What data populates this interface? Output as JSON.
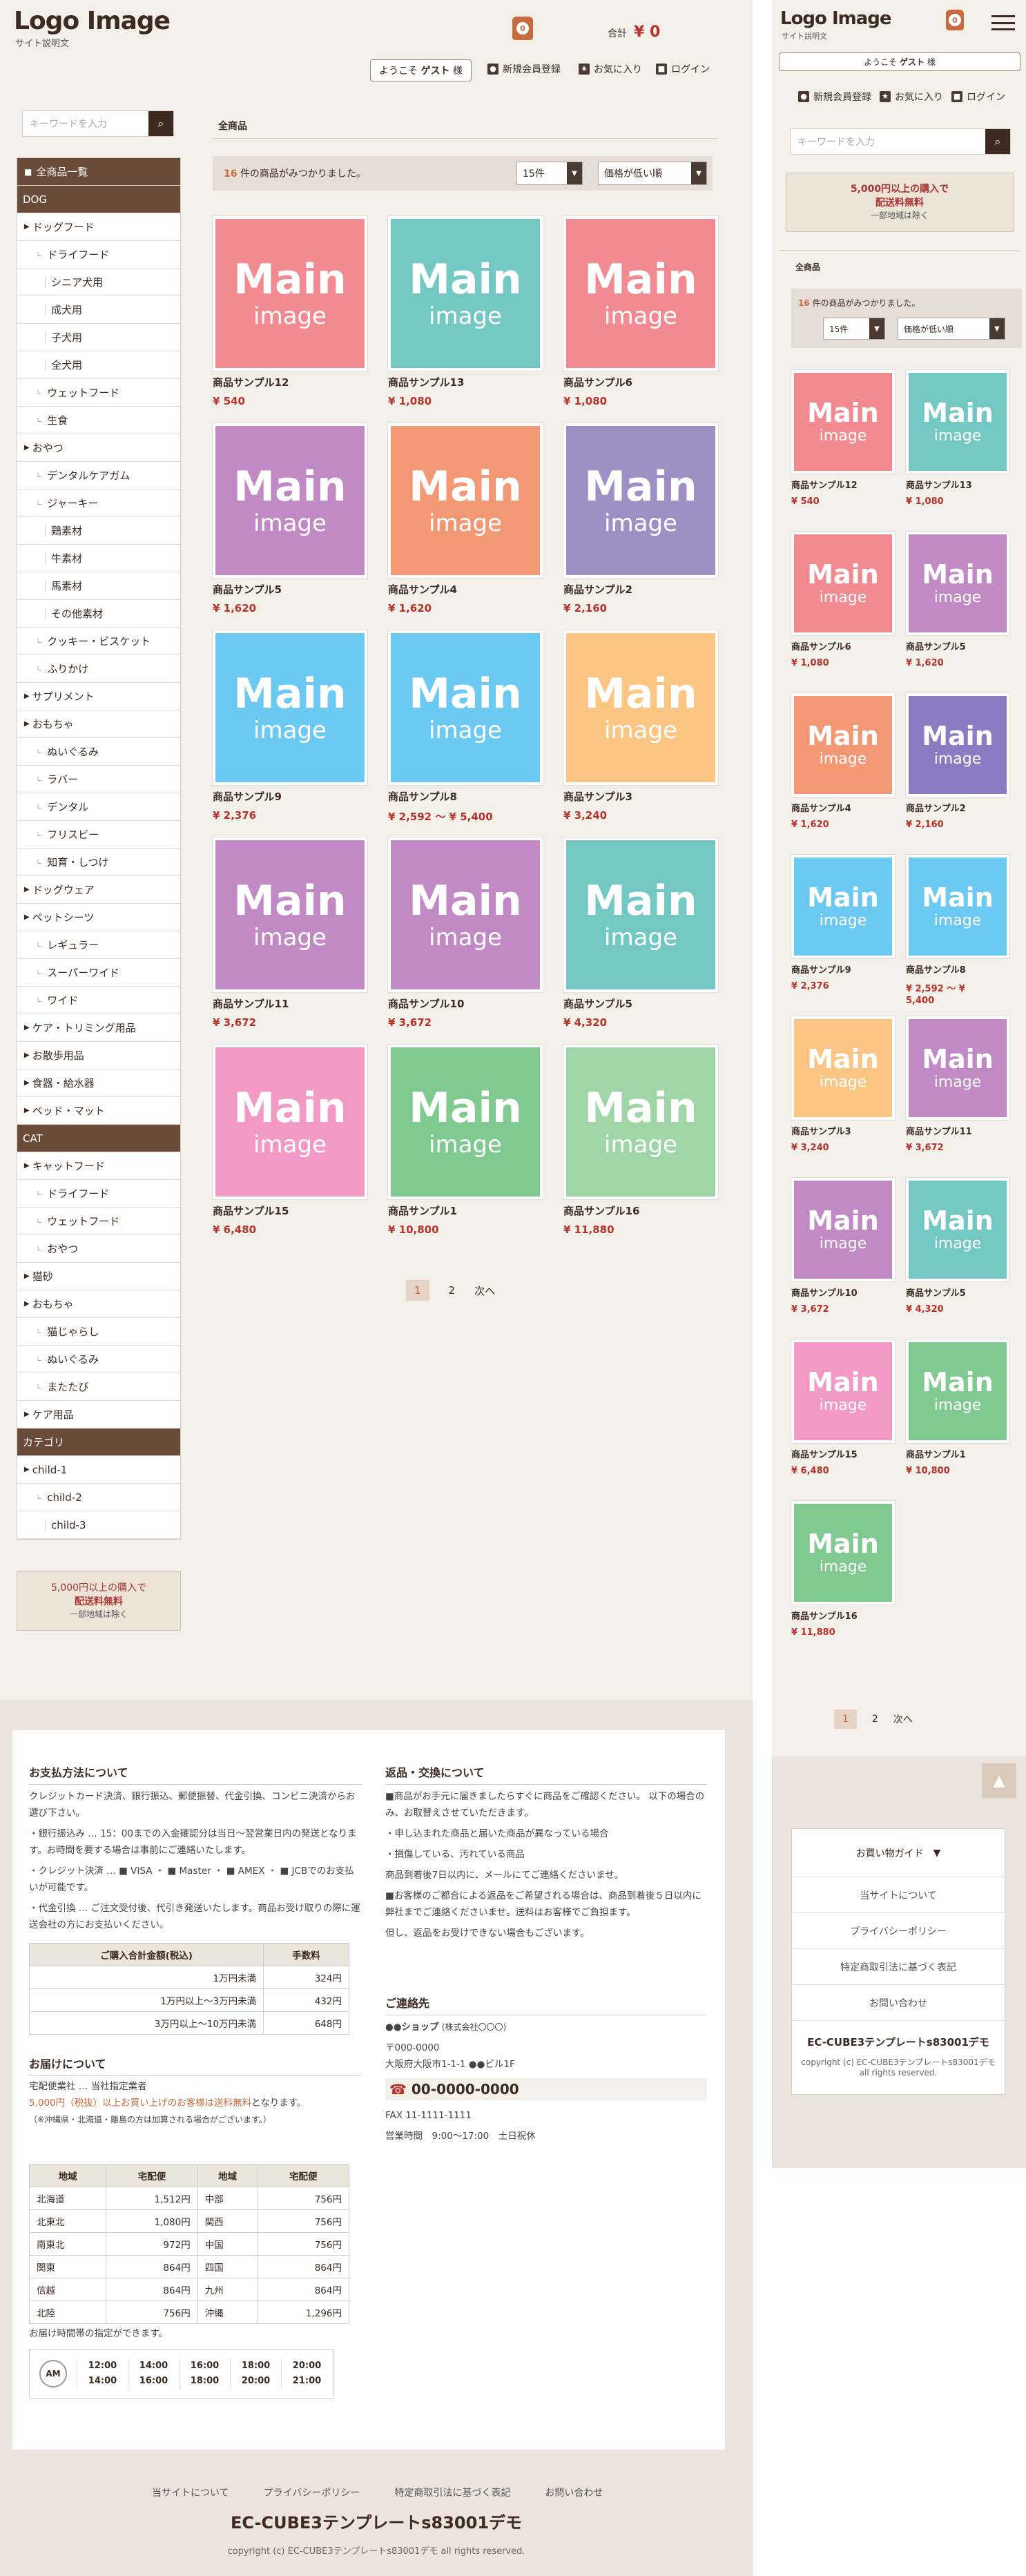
{
  "header": {
    "logo": "Logo Image",
    "sub": "サイト説明文",
    "cart_count": "0",
    "total_label": "合計",
    "total_value": "¥ 0",
    "welcome": "ようこそ",
    "guest": "ゲスト",
    "sama": "様",
    "links": [
      "新規会員登録",
      "お気に入り",
      "ログイン"
    ]
  },
  "search": {
    "placeholder": "キーワードを入力"
  },
  "sidebar": [
    {
      "t": "全商品一覧",
      "k": "top"
    },
    {
      "t": "DOG",
      "k": "h"
    },
    {
      "t": "ドッグフード",
      "k": "tri"
    },
    {
      "t": "ドライフード",
      "k": "s1"
    },
    {
      "t": "シニア犬用",
      "k": "s2"
    },
    {
      "t": "成犬用",
      "k": "s2"
    },
    {
      "t": "子犬用",
      "k": "s2"
    },
    {
      "t": "全犬用",
      "k": "s2"
    },
    {
      "t": "ウェットフード",
      "k": "s1"
    },
    {
      "t": "生食",
      "k": "s1"
    },
    {
      "t": "おやつ",
      "k": "tri"
    },
    {
      "t": "デンタルケアガム",
      "k": "s1"
    },
    {
      "t": "ジャーキー",
      "k": "s1"
    },
    {
      "t": "鶏素材",
      "k": "s2"
    },
    {
      "t": "牛素材",
      "k": "s2"
    },
    {
      "t": "馬素材",
      "k": "s2"
    },
    {
      "t": "その他素材",
      "k": "s2"
    },
    {
      "t": "クッキー・ビスケット",
      "k": "s1"
    },
    {
      "t": "ふりかけ",
      "k": "s1"
    },
    {
      "t": "サプリメント",
      "k": "tri"
    },
    {
      "t": "おもちゃ",
      "k": "tri"
    },
    {
      "t": "ぬいぐるみ",
      "k": "s1"
    },
    {
      "t": "ラバー",
      "k": "s1"
    },
    {
      "t": "デンタル",
      "k": "s1"
    },
    {
      "t": "フリスビー",
      "k": "s1"
    },
    {
      "t": "知育・しつけ",
      "k": "s1"
    },
    {
      "t": "ドッグウェア",
      "k": "tri"
    },
    {
      "t": "ペットシーツ",
      "k": "tri"
    },
    {
      "t": "レギュラー",
      "k": "s1"
    },
    {
      "t": "スーパーワイド",
      "k": "s1"
    },
    {
      "t": "ワイド",
      "k": "s1"
    },
    {
      "t": "ケア・トリミング用品",
      "k": "tri"
    },
    {
      "t": "お散歩用品",
      "k": "tri"
    },
    {
      "t": "食器・給水器",
      "k": "tri"
    },
    {
      "t": "ベッド・マット",
      "k": "tri"
    },
    {
      "t": "CAT",
      "k": "h"
    },
    {
      "t": "キャットフード",
      "k": "tri"
    },
    {
      "t": "ドライフード",
      "k": "s1"
    },
    {
      "t": "ウェットフード",
      "k": "s1"
    },
    {
      "t": "おやつ",
      "k": "s1"
    },
    {
      "t": "猫砂",
      "k": "tri"
    },
    {
      "t": "おもちゃ",
      "k": "tri"
    },
    {
      "t": "猫じゃらし",
      "k": "s1"
    },
    {
      "t": "ぬいぐるみ",
      "k": "s1"
    },
    {
      "t": "またたび",
      "k": "s1"
    },
    {
      "t": "ケア用品",
      "k": "tri"
    },
    {
      "t": "カテゴリ",
      "k": "h"
    },
    {
      "t": "child-1",
      "k": "tri"
    },
    {
      "t": "child-2",
      "k": "s1"
    },
    {
      "t": "child-3",
      "k": "s2"
    }
  ],
  "ship": {
    "l1": "5,000円以上の購入で",
    "l2": "配送料無料",
    "l3": "一部地域は除く"
  },
  "main": {
    "breadcrumb": "全商品",
    "count": "16",
    "count_text": "件の商品がみつかりました。",
    "per_page": "15件",
    "sort": "価格が低い順"
  },
  "products": [
    {
      "name": "商品サンプル12",
      "price": "¥ 540",
      "color": "#f28b91"
    },
    {
      "name": "商品サンプル13",
      "price": "¥ 1,080",
      "color": "#74c8c3"
    },
    {
      "name": "商品サンプル6",
      "price": "¥ 1,080",
      "color": "#f28b91"
    },
    {
      "name": "商品サンプル5",
      "price": "¥ 1,620",
      "color": "#c18ac4"
    },
    {
      "name": "商品サンプル4",
      "price": "¥ 1,620",
      "color": "#f29875"
    },
    {
      "name": "商品サンプル2",
      "price": "¥ 2,160",
      "color": "#a08fc4"
    },
    {
      "name": "商品サンプル9",
      "price": "¥ 2,376",
      "color": "#6ccaf2"
    },
    {
      "name": "商品サンプル8",
      "price": "¥ 2,592 ～ ¥ 5,400",
      "color": "#6ccaf2"
    },
    {
      "name": "商品サンプル3",
      "price": "¥ 3,240",
      "color": "#fbc583"
    },
    {
      "name": "商品サンプル11",
      "price": "¥ 3,672",
      "color": "#c18ac4"
    },
    {
      "name": "商品サンプル10",
      "price": "¥ 3,672",
      "color": "#c18ac4"
    },
    {
      "name": "商品サンプル5",
      "price": "¥ 4,320",
      "color": "#74c8c3"
    },
    {
      "name": "商品サンプル15",
      "price": "¥ 6,480",
      "color": "#f29ac5"
    },
    {
      "name": "商品サンプル1",
      "price": "¥ 10,800",
      "color": "#80c990"
    },
    {
      "name": "商品サンプル16",
      "price": "¥ 11,880",
      "color": "#9fd5a7"
    }
  ],
  "mobile_products": [
    {
      "name": "商品サンプル12",
      "price": "¥ 540",
      "color": "#f28b91"
    },
    {
      "name": "商品サンプル13",
      "price": "¥ 1,080",
      "color": "#74c8c3"
    },
    {
      "name": "商品サンプル6",
      "price": "¥ 1,080",
      "color": "#f28b91"
    },
    {
      "name": "商品サンプル5",
      "price": "¥ 1,620",
      "color": "#c18ac4"
    },
    {
      "name": "商品サンプル4",
      "price": "¥ 1,620",
      "color": "#f29875"
    },
    {
      "name": "商品サンプル2",
      "price": "¥ 2,160",
      "color": "#8a7bc2"
    },
    {
      "name": "商品サンプル9",
      "price": "¥ 2,376",
      "color": "#6ccaf2"
    },
    {
      "name": "商品サンプル8",
      "price": "¥ 2,592 ～ ¥",
      "price2": "5,400",
      "color": "#6ccaf2"
    },
    {
      "name": "商品サンプル3",
      "price": "¥ 3,240",
      "color": "#fbc583"
    },
    {
      "name": "商品サンプル11",
      "price": "¥ 3,672",
      "color": "#c18ac4"
    },
    {
      "name": "商品サンプル10",
      "price": "¥ 3,672",
      "color": "#c18ac4"
    },
    {
      "name": "商品サンプル5",
      "price": "¥ 4,320",
      "color": "#74c8c3"
    },
    {
      "name": "商品サンプル15",
      "price": "¥ 6,480",
      "color": "#f29ac5"
    },
    {
      "name": "商品サンプル1",
      "price": "¥ 10,800",
      "color": "#80c990"
    },
    {
      "name": "商品サンプル16",
      "price": "¥ 11,880",
      "color": "#80c990"
    }
  ],
  "tile": {
    "main": "Main",
    "image": "image"
  },
  "pagination": {
    "p1": "1",
    "p2": "2",
    "next": "次へ"
  },
  "footer": {
    "pay_title": "お支払方法について",
    "pay_text": "クレジットカード決済、銀行振込、郵便振替、代金引換、コンビニ決済からお選び下さい。",
    "pay_b1": "・銀行振込み … 15：00までの入金確認分は当日～翌営業日内の発送となります。お時間を要する場合は事前にご連絡いたします。",
    "pay_b2": "・クレジット決済 … ■ VISA ・ ■ Master ・ ■ AMEX ・ ■ JCBでのお支払いが可能です。",
    "pay_b3": "・代金引換 … ご注文受付後、代引き発送いたします。商品お受け取りの際に運送会社の方にお支払いください。",
    "fee_head": [
      "ご購入合計金額(税込)",
      "手数料"
    ],
    "fee_rows": [
      [
        "1万円未満",
        "324円"
      ],
      [
        "1万円以上～3万円未満",
        "432円"
      ],
      [
        "3万円以上～10万円未満",
        "648円"
      ]
    ],
    "deliv_title": "お届けについて",
    "deliv_t1": "宅配便業社 … 当社指定業者",
    "deliv_t2a": "5,000円（税抜）以上お買い上げのお客様は",
    "deliv_t2b": "送料無料",
    "deliv_t2c": "となります。",
    "deliv_t3": "（※沖縄県・北海道・離島の方は加算される場合がございます。）",
    "deliv_head": [
      "地域",
      "宅配便",
      "地域",
      "宅配便"
    ],
    "deliv_rows": [
      [
        "北海道",
        "1,512円",
        "中部",
        "756円"
      ],
      [
        "北東北",
        "1,080円",
        "関西",
        "756円"
      ],
      [
        "南東北",
        "972円",
        "中国",
        "756円"
      ],
      [
        "関東",
        "864円",
        "四国",
        "864円"
      ],
      [
        "信越",
        "864円",
        "九州",
        "864円"
      ],
      [
        "北陸",
        "756円",
        "沖縄",
        "1,296円"
      ]
    ],
    "time_title": "お届け時間帯の指定ができます。",
    "am": "AM",
    "times": [
      [
        "12:00",
        "14:00"
      ],
      [
        "14:00",
        "16:00"
      ],
      [
        "16:00",
        "18:00"
      ],
      [
        "18:00",
        "20:00"
      ],
      [
        "20:00",
        "21:00"
      ]
    ],
    "ret_title": "返品・交換について",
    "ret_1": "■商品がお手元に届きましたらすぐに商品をご確認ください。 以下の場合のみ、お取替えさせていただきます。",
    "ret_2": "・申し込まれた商品と届いた商品が異なっている場合",
    "ret_3": "・損傷している、汚れている商品",
    "ret_4": "商品到着後7日以内に、メールにてご連絡くださいませ。",
    "ret_5": "■お客様のご都合による返品をご希望される場合は、商品到着後５日以内に弊社までご連絡くださいませ。送料はお客様でご負担ます。",
    "ret_6": "但し、返品をお受けできない場合もございます。",
    "contact_title": "ご連絡先",
    "shop": "●●ショップ",
    "shop_sub": "(株式会社〇〇〇)",
    "zip": "〒000-0000",
    "addr": "大阪府大阪市1-1-1 ●●ビル1F",
    "tel": "00-0000-0000",
    "fax": "FAX 11-1111-1111",
    "hours": "営業時間　9:00～17:00　土日祝休",
    "links": [
      "当サイトについて",
      "プライバシーポリシー",
      "特定商取引法に基づく表記",
      "お問い合わせ"
    ],
    "name": "EC-CUBE3テンプレートs83001デモ",
    "copy": "copyright (c) EC-CUBE3テンプレートs83001デモ all rights reserved."
  },
  "mobile": {
    "guide": "お買い物ガイド",
    "copy1": "copyright (c) EC-CUBE3テンプレートs83001デモ",
    "copy2": "all rights reserved."
  }
}
